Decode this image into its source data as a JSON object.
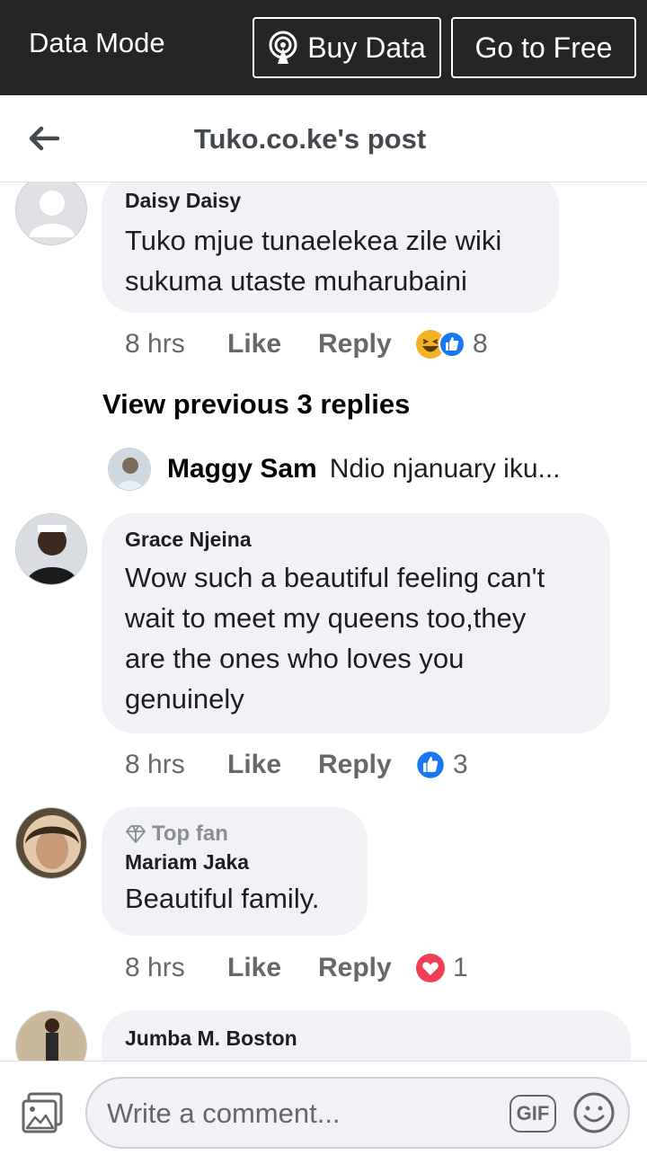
{
  "data_bar": {
    "mode_label": "Data Mode",
    "buy_data_label": "Buy Data",
    "go_free_label": "Go to Free"
  },
  "header": {
    "title": "Tuko.co.ke's post"
  },
  "comments": [
    {
      "author": "Daisy Daisy",
      "lines": [
        "Tuko mjue tunaelekea zile wiki",
        "sukuma utaste muharubaini"
      ],
      "time": "8 hrs",
      "like_label": "Like",
      "reply_label": "Reply",
      "reactions": [
        "haha",
        "like"
      ],
      "reaction_count": "8"
    },
    {
      "author": "Grace Njeina",
      "lines": [
        "Wow such a beautiful feeling can't",
        "wait to meet my queens too,they",
        "are the ones who loves you",
        "genuinely"
      ],
      "time": "8 hrs",
      "like_label": "Like",
      "reply_label": "Reply",
      "reactions": [
        "like"
      ],
      "reaction_count": "3"
    },
    {
      "badge": "Top fan",
      "author": "Mariam Jaka",
      "lines": [
        "Beautiful family."
      ],
      "time": "8 hrs",
      "like_label": "Like",
      "reply_label": "Reply",
      "reactions": [
        "love"
      ],
      "reaction_count": "1"
    },
    {
      "author": "Jumba M. Boston",
      "lines": []
    }
  ],
  "view_previous_label": "View previous 3 replies",
  "reply_preview": {
    "author": "Maggy Sam",
    "text": "Ndio njanuary iku..."
  },
  "composer": {
    "placeholder": "Write a comment...",
    "gif_label": "GIF"
  },
  "colors": {
    "data_bar_bg": "#242526",
    "bubble_bg": "#f0f2f5",
    "like_blue": "#1877f2",
    "love_red": "#f33e58",
    "haha_yellow": "#f7b125"
  }
}
